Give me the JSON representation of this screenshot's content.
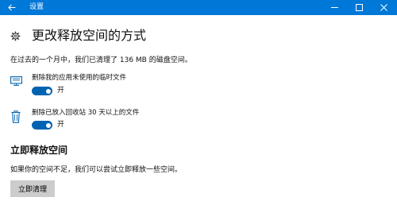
{
  "window": {
    "title": "设置",
    "back_icon": "back-arrow-icon",
    "title_bar_color": "#0078d7"
  },
  "page": {
    "title": "更改释放空间的方式",
    "title_icon": "gear-icon"
  },
  "summary": "在过去的一个月中，我们已清理了 136 MB 的磁盘空间。",
  "options": [
    {
      "icon": "monitor-icon",
      "label": "删除我的应用未使用的临时文件",
      "toggle_state": "开",
      "on": true
    },
    {
      "icon": "trash-icon",
      "label": "删除已放入回收站 30 天以上的文件",
      "toggle_state": "开",
      "on": true
    }
  ],
  "free_now": {
    "title": "立即释放空间",
    "description": "如果你的空间不足，我们可以尝试立即释放一些空间。",
    "button_label": "立即清理"
  },
  "colors": {
    "accent": "#0078d7",
    "toggle_on": "#0063b1",
    "button_bg": "#cccccc"
  }
}
